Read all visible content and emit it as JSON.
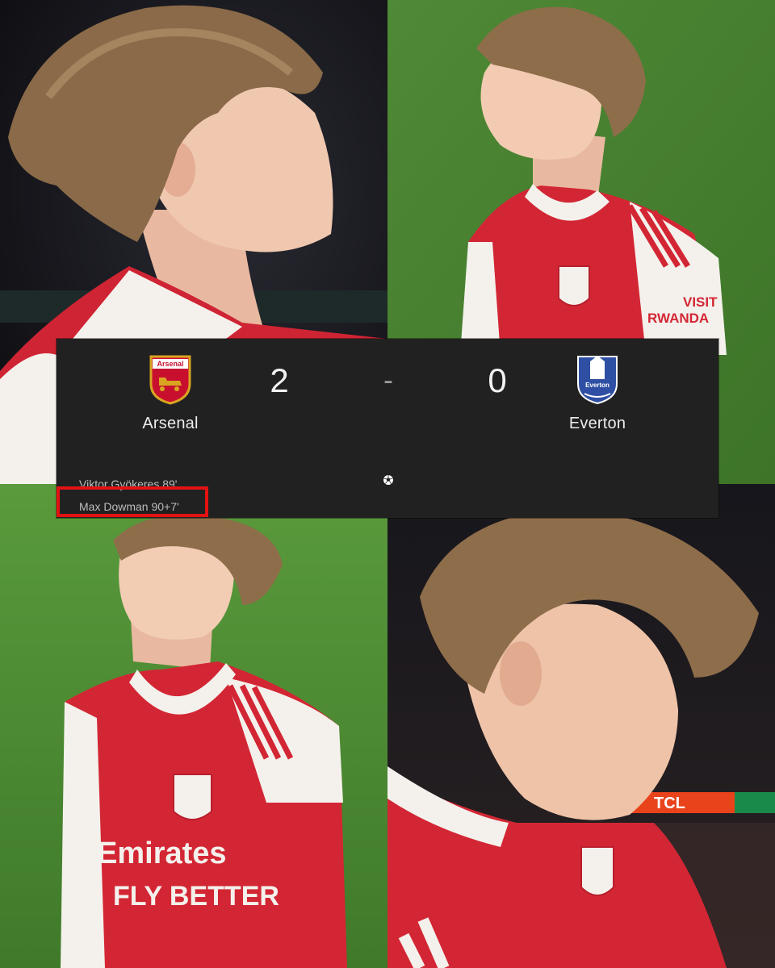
{
  "match": {
    "home": {
      "team": "Arsenal",
      "score": "2",
      "crest_text": "Arsenal",
      "crest_color": "#c8102e"
    },
    "away": {
      "team": "Everton",
      "score": "0",
      "crest_text": "Everton",
      "crest_color": "#2e4fa3"
    },
    "separator": "-",
    "scorers": [
      {
        "text": "Viktor Gyökeres 89'"
      },
      {
        "text": "Max Dowman 90+7'",
        "highlighted": true
      }
    ],
    "highlight_color": "#e31212"
  },
  "photo_text": {
    "sleeve_sponsor_1": "VISIT",
    "sleeve_sponsor_2": "RWANDA",
    "shirt_sponsor_1": "Emirates",
    "shirt_sponsor_2": "FLY BETTER",
    "board_text": "TCL"
  },
  "icons": [
    "arsenal-crest-icon",
    "everton-crest-icon",
    "football-icon"
  ]
}
